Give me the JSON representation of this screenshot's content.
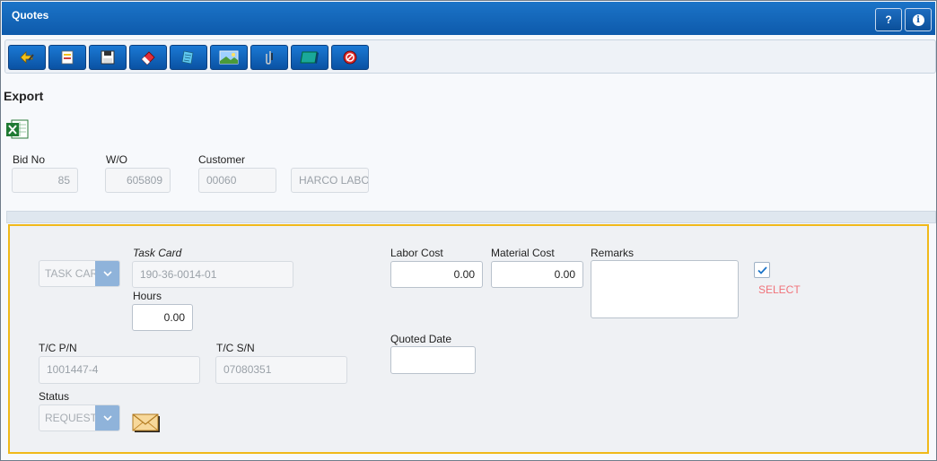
{
  "window": {
    "title": "Quotes",
    "help_label": "?",
    "info_label": "i"
  },
  "toolbar": {
    "buttons": [
      {
        "icon": "refresh-icon"
      },
      {
        "icon": "new-document-icon"
      },
      {
        "icon": "save-icon"
      },
      {
        "icon": "eraser-icon"
      },
      {
        "icon": "notes-icon"
      },
      {
        "icon": "image-icon"
      },
      {
        "icon": "attachment-icon"
      },
      {
        "icon": "screen-icon"
      },
      {
        "icon": "cancel-icon"
      }
    ]
  },
  "export": {
    "title": "Export",
    "icon": "excel-icon"
  },
  "header": {
    "bid_no_label": "Bid No",
    "bid_no": "85",
    "wo_label": "W/O",
    "wo": "605809",
    "customer_label": "Customer",
    "customer": "00060",
    "customer_name": "HARCO LABOR"
  },
  "form": {
    "type_select": "TASK CARD",
    "task_card_label": "Task Card",
    "task_card": "190-36-0014-01",
    "hours_label": "Hours",
    "hours": "0.00",
    "tc_pn_label": "T/C P/N",
    "tc_pn": "1001447-4",
    "tc_sn_label": "T/C S/N",
    "tc_sn": "07080351",
    "status_label": "Status",
    "status": "REQUESTED",
    "labor_cost_label": "Labor Cost",
    "labor_cost": "0.00",
    "material_cost_label": "Material Cost",
    "material_cost": "0.00",
    "remarks_label": "Remarks",
    "remarks": "",
    "quoted_date_label": "Quoted Date",
    "quoted_date": "",
    "select_label": "SELECT",
    "select_checked": true
  }
}
